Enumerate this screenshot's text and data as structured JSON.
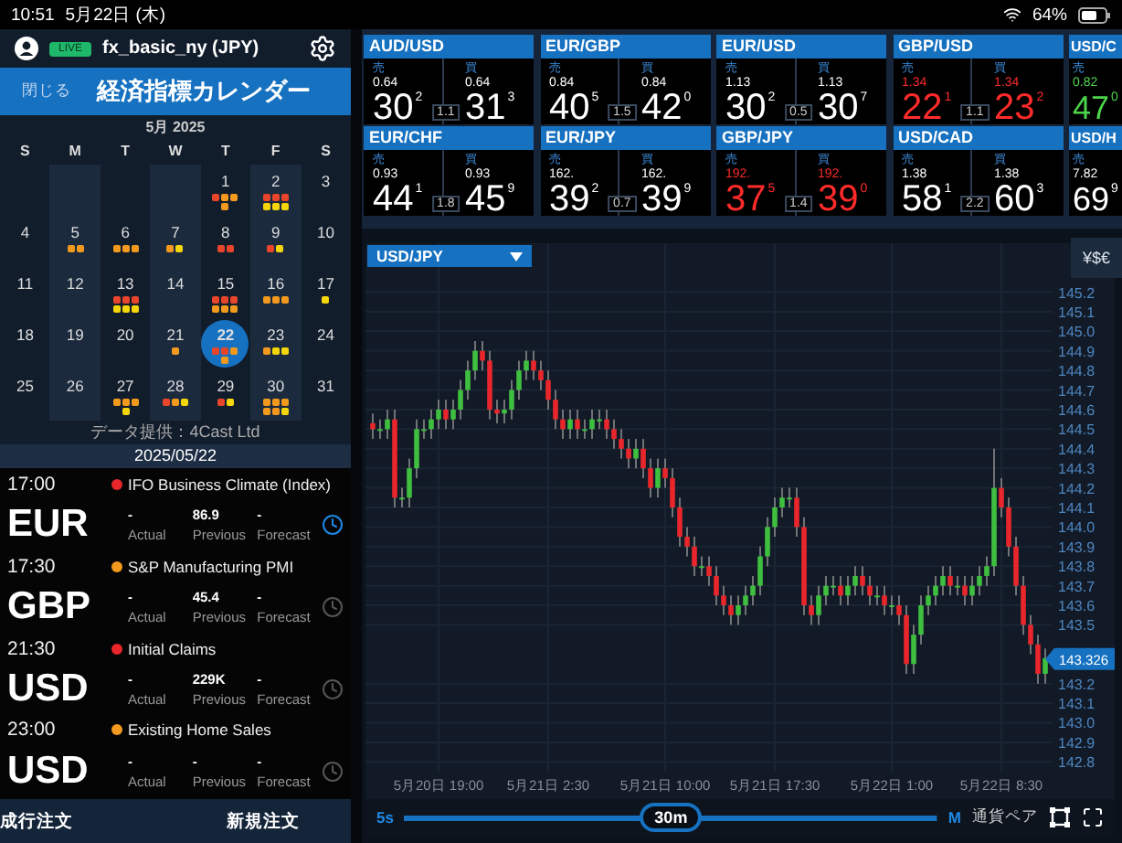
{
  "status_bar": {
    "time": "10:51",
    "date": "5月22日 (木)",
    "battery": "64%"
  },
  "account": {
    "badge": "LIVE",
    "name": "fx_basic_ny (JPY)"
  },
  "calendar_header": {
    "close": "閉じる",
    "title": "経済指標カレンダー"
  },
  "calendar": {
    "month": "5月 2025",
    "weekdays": [
      "S",
      "M",
      "T",
      "W",
      "T",
      "F",
      "S"
    ],
    "weeks": [
      {
        "days": [
          {
            "kind": "blank"
          },
          {
            "kind": "blank"
          },
          {
            "kind": "blank"
          },
          {
            "kind": "blank"
          },
          {
            "kind": "day",
            "day": "1",
            "selected": false,
            "dots": [
              {
                "color": "#e8452a"
              },
              {
                "color": "#f39a1e"
              },
              {
                "color": "#f39a1e"
              },
              {
                "color": "#f39a1e"
              }
            ]
          },
          {
            "kind": "day",
            "day": "2",
            "selected": false,
            "dots": [
              {
                "color": "#e8452a"
              },
              {
                "color": "#e8452a"
              },
              {
                "color": "#e8452a"
              },
              {
                "color": "#f5d60a"
              },
              {
                "color": "#f5d60a"
              },
              {
                "color": "#f5d60a"
              }
            ]
          },
          {
            "kind": "day",
            "day": "3",
            "selected": false
          }
        ]
      },
      {
        "days": [
          {
            "kind": "day",
            "day": "4",
            "selected": false
          },
          {
            "kind": "day",
            "day": "5",
            "selected": false,
            "dots": [
              {
                "color": "#f39a1e"
              },
              {
                "color": "#f39a1e"
              }
            ]
          },
          {
            "kind": "day",
            "day": "6",
            "selected": false,
            "dots": [
              {
                "color": "#f39a1e"
              },
              {
                "color": "#f39a1e"
              },
              {
                "color": "#f39a1e"
              }
            ]
          },
          {
            "kind": "day",
            "day": "7",
            "selected": false,
            "dots": [
              {
                "color": "#f39a1e"
              },
              {
                "color": "#f5d60a"
              }
            ]
          },
          {
            "kind": "day",
            "day": "8",
            "selected": false,
            "dots": [
              {
                "color": "#e8452a"
              },
              {
                "color": "#e8452a"
              }
            ]
          },
          {
            "kind": "day",
            "day": "9",
            "selected": false,
            "dots": [
              {
                "color": "#e8452a"
              },
              {
                "color": "#f5d60a"
              }
            ]
          },
          {
            "kind": "day",
            "day": "10",
            "selected": false
          }
        ]
      },
      {
        "days": [
          {
            "kind": "day",
            "day": "11",
            "selected": false
          },
          {
            "kind": "day",
            "day": "12",
            "selected": false
          },
          {
            "kind": "day",
            "day": "13",
            "selected": false,
            "dots": [
              {
                "color": "#e8452a"
              },
              {
                "color": "#e8452a"
              },
              {
                "color": "#e8452a"
              },
              {
                "color": "#f5d60a"
              },
              {
                "color": "#f5d60a"
              },
              {
                "color": "#f5d60a"
              }
            ]
          },
          {
            "kind": "day",
            "day": "14",
            "selected": false
          },
          {
            "kind": "day",
            "day": "15",
            "selected": false,
            "dots": [
              {
                "color": "#e8452a"
              },
              {
                "color": "#e8452a"
              },
              {
                "color": "#e8452a"
              },
              {
                "color": "#f39a1e"
              },
              {
                "color": "#f39a1e"
              },
              {
                "color": "#f39a1e"
              }
            ]
          },
          {
            "kind": "day",
            "day": "16",
            "selected": false,
            "dots": [
              {
                "color": "#f39a1e"
              },
              {
                "color": "#f39a1e"
              },
              {
                "color": "#f39a1e"
              }
            ]
          },
          {
            "kind": "day",
            "day": "17",
            "selected": false,
            "dots": [
              {
                "color": "#f5d60a"
              }
            ]
          }
        ]
      },
      {
        "days": [
          {
            "kind": "day",
            "day": "18",
            "selected": false
          },
          {
            "kind": "day",
            "day": "19",
            "selected": false
          },
          {
            "kind": "day",
            "day": "20",
            "selected": false
          },
          {
            "kind": "day",
            "day": "21",
            "selected": false,
            "dots": [
              {
                "color": "#f39a1e"
              }
            ]
          },
          {
            "kind": "day",
            "day": "22",
            "selected": true,
            "dots": [
              {
                "color": "#e8452a"
              },
              {
                "color": "#e8452a"
              },
              {
                "color": "#f39a1e"
              },
              {
                "color": "#f39a1e"
              }
            ]
          },
          {
            "kind": "day",
            "day": "23",
            "selected": false,
            "dots": [
              {
                "color": "#f39a1e"
              },
              {
                "color": "#f5d60a"
              },
              {
                "color": "#f5d60a"
              }
            ]
          },
          {
            "kind": "day",
            "day": "24",
            "selected": false
          }
        ]
      },
      {
        "days": [
          {
            "kind": "day",
            "day": "25",
            "selected": false
          },
          {
            "kind": "day",
            "day": "26",
            "selected": false
          },
          {
            "kind": "day",
            "day": "27",
            "selected": false,
            "dots": [
              {
                "color": "#f39a1e"
              },
              {
                "color": "#f39a1e"
              },
              {
                "color": "#f39a1e"
              },
              {
                "color": "#f5d60a"
              }
            ]
          },
          {
            "kind": "day",
            "day": "28",
            "selected": false,
            "dots": [
              {
                "color": "#e8452a"
              },
              {
                "color": "#f39a1e"
              },
              {
                "color": "#f5d60a"
              }
            ]
          },
          {
            "kind": "day",
            "day": "29",
            "selected": false,
            "dots": [
              {
                "color": "#e8452a"
              },
              {
                "color": "#f5d60a"
              }
            ]
          },
          {
            "kind": "day",
            "day": "30",
            "selected": false,
            "dots": [
              {
                "color": "#f39a1e"
              },
              {
                "color": "#f39a1e"
              },
              {
                "color": "#f39a1e"
              },
              {
                "color": "#f39a1e"
              },
              {
                "color": "#f39a1e"
              },
              {
                "color": "#f5d60a"
              }
            ]
          },
          {
            "kind": "day",
            "day": "31",
            "selected": false
          }
        ]
      }
    ]
  },
  "source": "データ提供：4Cast Ltd",
  "date": "2025/05/22",
  "events": [
    {
      "time": "17:00",
      "color": "#e8262b",
      "title": "IFO Business Climate (Index)",
      "currency": "EUR",
      "alert": true,
      "fields": [
        {
          "value": "-",
          "label": "Actual"
        },
        {
          "value": "86.9",
          "label": "Previous"
        },
        {
          "value": "-",
          "label": "Forecast"
        }
      ]
    },
    {
      "time": "17:30",
      "color": "#f39a1e",
      "title": "S&P Manufacturing PMI",
      "currency": "GBP",
      "alert": false,
      "fields": [
        {
          "value": "-",
          "label": "Actual"
        },
        {
          "value": "45.4",
          "label": "Previous"
        },
        {
          "value": "-",
          "label": "Forecast"
        }
      ]
    },
    {
      "time": "21:30",
      "color": "#e8262b",
      "title": "Initial Claims",
      "currency": "USD",
      "alert": false,
      "fields": [
        {
          "value": "-",
          "label": "Actual"
        },
        {
          "value": "229K",
          "label": "Previous"
        },
        {
          "value": "-",
          "label": "Forecast"
        }
      ]
    },
    {
      "time": "23:00",
      "color": "#f39a1e",
      "title": "Existing Home Sales",
      "currency": "USD",
      "alert": false,
      "fields": [
        {
          "value": "-",
          "label": "Actual"
        },
        {
          "value": "-",
          "label": "Previous"
        },
        {
          "value": "-",
          "label": "Forecast"
        }
      ]
    }
  ],
  "order_bar": [
    "成行注文",
    "新規注文"
  ],
  "quotes": [
    {
      "pair": "AUD/USD",
      "color": "#ffffff",
      "sell": {
        "label": "売",
        "prefix": "0.64",
        "big": "30",
        "pip": "2"
      },
      "buy": {
        "label": "買",
        "prefix": "0.64",
        "big": "31",
        "pip": "3"
      },
      "spread": "1.1"
    },
    {
      "pair": "EUR/GBP",
      "color": "#ffffff",
      "sell": {
        "label": "売",
        "prefix": "0.84",
        "big": "40",
        "pip": "5"
      },
      "buy": {
        "label": "買",
        "prefix": "0.84",
        "big": "42",
        "pip": "0"
      },
      "spread": "1.5"
    },
    {
      "pair": "EUR/USD",
      "color": "#ffffff",
      "sell": {
        "label": "売",
        "prefix": "1.13",
        "big": "30",
        "pip": "2"
      },
      "buy": {
        "label": "買",
        "prefix": "1.13",
        "big": "30",
        "pip": "7"
      },
      "spread": "0.5"
    },
    {
      "pair": "GBP/USD",
      "color": "#ff2b2b",
      "sell": {
        "label": "売",
        "prefix": "1.34",
        "big": "22",
        "pip": "1"
      },
      "buy": {
        "label": "買",
        "prefix": "1.34",
        "big": "23",
        "pip": "2"
      },
      "spread": "1.1"
    },
    {
      "pair": "USD/C",
      "color": "#4cd44c",
      "sell": {
        "label": "売",
        "prefix": "0.82",
        "big": "47",
        "pip": "0"
      }
    },
    {
      "pair": "EUR/CHF",
      "color": "#ffffff",
      "sell": {
        "label": "売",
        "prefix": "0.93",
        "big": "44",
        "pip": "1"
      },
      "buy": {
        "label": "買",
        "prefix": "0.93",
        "big": "45",
        "pip": "9"
      },
      "spread": "1.8"
    },
    {
      "pair": "EUR/JPY",
      "color": "#ffffff",
      "sell": {
        "label": "売",
        "prefix": "162.",
        "big": "39",
        "pip": "2"
      },
      "buy": {
        "label": "買",
        "prefix": "162.",
        "big": "39",
        "pip": "9"
      },
      "spread": "0.7"
    },
    {
      "pair": "GBP/JPY",
      "color": "#ff2b2b",
      "sell": {
        "label": "売",
        "prefix": "192.",
        "big": "37",
        "pip": "5"
      },
      "buy": {
        "label": "買",
        "prefix": "192.",
        "big": "39",
        "pip": "0"
      },
      "spread": "1.4"
    },
    {
      "pair": "USD/CAD",
      "color": "#ffffff",
      "sell": {
        "label": "売",
        "prefix": "1.38",
        "big": "58",
        "pip": "1"
      },
      "buy": {
        "label": "買",
        "prefix": "1.38",
        "big": "60",
        "pip": "3"
      },
      "spread": "2.2"
    },
    {
      "pair": "USD/H",
      "color": "#ffffff",
      "sell": {
        "label": "売",
        "prefix": "7.82",
        "big": "69",
        "pip": "9"
      }
    }
  ],
  "chart": {
    "pair": "USD/JPY",
    "currency_button": "¥$€",
    "price_tag": "143.326",
    "chart_data": {
      "type": "candlestick",
      "ylim": [
        142.75,
        145.45
      ],
      "grid": true,
      "categories": [
        null,
        null,
        null,
        null,
        null,
        null,
        null,
        null,
        null,
        "5月20日 19:00",
        null,
        null,
        null,
        null,
        null,
        null,
        null,
        null,
        null,
        null,
        null,
        null,
        null,
        null,
        "5月21日 2:30",
        null,
        null,
        null,
        null,
        null,
        null,
        null,
        null,
        null,
        null,
        null,
        null,
        null,
        null,
        null,
        "5月21日 10:00",
        null,
        null,
        null,
        null,
        null,
        null,
        null,
        null,
        null,
        null,
        null,
        null,
        null,
        null,
        "5月21日 17:30",
        null,
        null,
        null,
        null,
        null,
        null,
        null,
        null,
        null,
        null,
        null,
        null,
        null,
        null,
        null,
        "5月22日 1:00",
        null,
        null,
        null,
        null,
        null,
        null,
        null,
        null,
        null,
        null,
        null,
        null,
        null,
        null,
        "5月22日 8:30",
        null,
        null,
        null,
        null,
        null,
        null
      ],
      "ohlc": [
        [
          144.53,
          144.58,
          144.45,
          144.5
        ],
        [
          144.5,
          144.55,
          144.45,
          144.5
        ],
        [
          144.5,
          144.6,
          144.45,
          144.55
        ],
        [
          144.55,
          144.6,
          144.1,
          144.15
        ],
        [
          144.15,
          144.2,
          144.1,
          144.15
        ],
        [
          144.15,
          144.35,
          144.1,
          144.3
        ],
        [
          144.3,
          144.55,
          144.25,
          144.5
        ],
        [
          144.5,
          144.55,
          144.45,
          144.5
        ],
        [
          144.5,
          144.6,
          144.45,
          144.55
        ],
        [
          144.55,
          144.65,
          144.5,
          144.6
        ],
        [
          144.6,
          144.65,
          144.5,
          144.55
        ],
        [
          144.55,
          144.65,
          144.5,
          144.6
        ],
        [
          144.6,
          144.75,
          144.55,
          144.7
        ],
        [
          144.7,
          144.85,
          144.65,
          144.8
        ],
        [
          144.8,
          144.95,
          144.75,
          144.9
        ],
        [
          144.9,
          144.95,
          144.8,
          144.85
        ],
        [
          144.85,
          144.9,
          144.55,
          144.6
        ],
        [
          144.6,
          144.65,
          144.53,
          144.58
        ],
        [
          144.58,
          144.65,
          144.53,
          144.6
        ],
        [
          144.6,
          144.75,
          144.55,
          144.7
        ],
        [
          144.7,
          144.85,
          144.65,
          144.8
        ],
        [
          144.8,
          144.9,
          144.75,
          144.85
        ],
        [
          144.85,
          144.9,
          144.75,
          144.8
        ],
        [
          144.8,
          144.85,
          144.7,
          144.75
        ],
        [
          144.75,
          144.8,
          144.6,
          144.65
        ],
        [
          144.65,
          144.7,
          144.5,
          144.55
        ],
        [
          144.55,
          144.6,
          144.45,
          144.5
        ],
        [
          144.5,
          144.6,
          144.45,
          144.55
        ],
        [
          144.55,
          144.6,
          144.45,
          144.5
        ],
        [
          144.5,
          144.55,
          144.45,
          144.5
        ],
        [
          144.5,
          144.6,
          144.45,
          144.55
        ],
        [
          144.55,
          144.6,
          144.5,
          144.55
        ],
        [
          144.55,
          144.6,
          144.45,
          144.5
        ],
        [
          144.5,
          144.55,
          144.4,
          144.45
        ],
        [
          144.45,
          144.5,
          144.35,
          144.4
        ],
        [
          144.4,
          144.45,
          144.3,
          144.35
        ],
        [
          144.35,
          144.45,
          144.3,
          144.4
        ],
        [
          144.4,
          144.45,
          144.25,
          144.3
        ],
        [
          144.3,
          144.35,
          144.15,
          144.2
        ],
        [
          144.2,
          144.35,
          144.15,
          144.3
        ],
        [
          144.3,
          144.35,
          144.2,
          144.25
        ],
        [
          144.25,
          144.3,
          144.05,
          144.1
        ],
        [
          144.1,
          144.15,
          143.9,
          143.95
        ],
        [
          143.95,
          144.0,
          143.85,
          143.9
        ],
        [
          143.9,
          143.95,
          143.75,
          143.8
        ],
        [
          143.8,
          143.85,
          143.75,
          143.8
        ],
        [
          143.8,
          143.85,
          143.7,
          143.75
        ],
        [
          143.75,
          143.8,
          143.6,
          143.65
        ],
        [
          143.65,
          143.7,
          143.55,
          143.6
        ],
        [
          143.6,
          143.65,
          143.5,
          143.55
        ],
        [
          143.55,
          143.65,
          143.5,
          143.6
        ],
        [
          143.6,
          143.7,
          143.55,
          143.65
        ],
        [
          143.65,
          143.75,
          143.6,
          143.7
        ],
        [
          143.7,
          143.9,
          143.65,
          143.85
        ],
        [
          143.85,
          144.05,
          143.8,
          144.0
        ],
        [
          144.0,
          144.15,
          143.95,
          144.1
        ],
        [
          144.1,
          144.2,
          144.05,
          144.15
        ],
        [
          144.15,
          144.2,
          144.1,
          144.15
        ],
        [
          144.15,
          144.2,
          143.95,
          144.0
        ],
        [
          144.0,
          144.05,
          143.55,
          143.6
        ],
        [
          143.6,
          143.65,
          143.5,
          143.55
        ],
        [
          143.55,
          143.7,
          143.5,
          143.65
        ],
        [
          143.65,
          143.75,
          143.6,
          143.7
        ],
        [
          143.7,
          143.75,
          143.65,
          143.7
        ],
        [
          143.7,
          143.75,
          143.6,
          143.65
        ],
        [
          143.65,
          143.75,
          143.6,
          143.7
        ],
        [
          143.7,
          143.8,
          143.65,
          143.75
        ],
        [
          143.75,
          143.8,
          143.65,
          143.7
        ],
        [
          143.7,
          143.75,
          143.6,
          143.65
        ],
        [
          143.65,
          143.7,
          143.6,
          143.65
        ],
        [
          143.65,
          143.7,
          143.55,
          143.6
        ],
        [
          143.6,
          143.65,
          143.55,
          143.6
        ],
        [
          143.6,
          143.65,
          143.5,
          143.55
        ],
        [
          143.55,
          143.6,
          143.25,
          143.3
        ],
        [
          143.3,
          143.5,
          143.25,
          143.45
        ],
        [
          143.45,
          143.65,
          143.4,
          143.6
        ],
        [
          143.6,
          143.7,
          143.55,
          143.65
        ],
        [
          143.65,
          143.75,
          143.6,
          143.7
        ],
        [
          143.7,
          143.8,
          143.65,
          143.75
        ],
        [
          143.75,
          143.8,
          143.65,
          143.7
        ],
        [
          143.7,
          143.75,
          143.65,
          143.7
        ],
        [
          143.7,
          143.75,
          143.6,
          143.65
        ],
        [
          143.65,
          143.75,
          143.6,
          143.7
        ],
        [
          143.7,
          143.8,
          143.65,
          143.75
        ],
        [
          143.75,
          143.85,
          143.7,
          143.8
        ],
        [
          143.8,
          144.4,
          143.75,
          144.2
        ],
        [
          144.2,
          144.25,
          144.05,
          144.1
        ],
        [
          144.1,
          144.15,
          143.85,
          143.9
        ],
        [
          143.9,
          143.95,
          143.65,
          143.7
        ],
        [
          143.7,
          143.75,
          143.45,
          143.5
        ],
        [
          143.5,
          143.55,
          143.35,
          143.4
        ],
        [
          143.4,
          143.45,
          143.2,
          143.25
        ],
        [
          143.25,
          143.38,
          143.2,
          143.33
        ]
      ],
      "yticks": [
        {
          "value": 145.2,
          "label": "145.2"
        },
        {
          "value": 145.1,
          "label": "145.1"
        },
        {
          "value": 145.0,
          "label": "145.0"
        },
        {
          "value": 144.9,
          "label": "144.9"
        },
        {
          "value": 144.8,
          "label": "144.8"
        },
        {
          "value": 144.7,
          "label": "144.7"
        },
        {
          "value": 144.6,
          "label": "144.6"
        },
        {
          "value": 144.5,
          "label": "144.5"
        },
        {
          "value": 144.4,
          "label": "144.4"
        },
        {
          "value": 144.3,
          "label": "144.3"
        },
        {
          "value": 144.2,
          "label": "144.2"
        },
        {
          "value": 144.1,
          "label": "144.1"
        },
        {
          "value": 144.0,
          "label": "144.0"
        },
        {
          "value": 143.9,
          "label": "143.9"
        },
        {
          "value": 143.8,
          "label": "143.8"
        },
        {
          "value": 143.7,
          "label": "143.7"
        },
        {
          "value": 143.6,
          "label": "143.6"
        },
        {
          "value": 143.5,
          "label": "143.5"
        },
        {
          "value": 143.2,
          "label": "143.2"
        },
        {
          "value": 143.1,
          "label": "143.1"
        },
        {
          "value": 143.0,
          "label": "143.0"
        },
        {
          "value": 142.9,
          "label": "142.9"
        },
        {
          "value": 142.8,
          "label": "142.8"
        }
      ]
    },
    "timeframe": {
      "min": "5s",
      "current": "30m",
      "max": "M",
      "level": 0.5
    },
    "pair_button": "通貨ペア"
  }
}
